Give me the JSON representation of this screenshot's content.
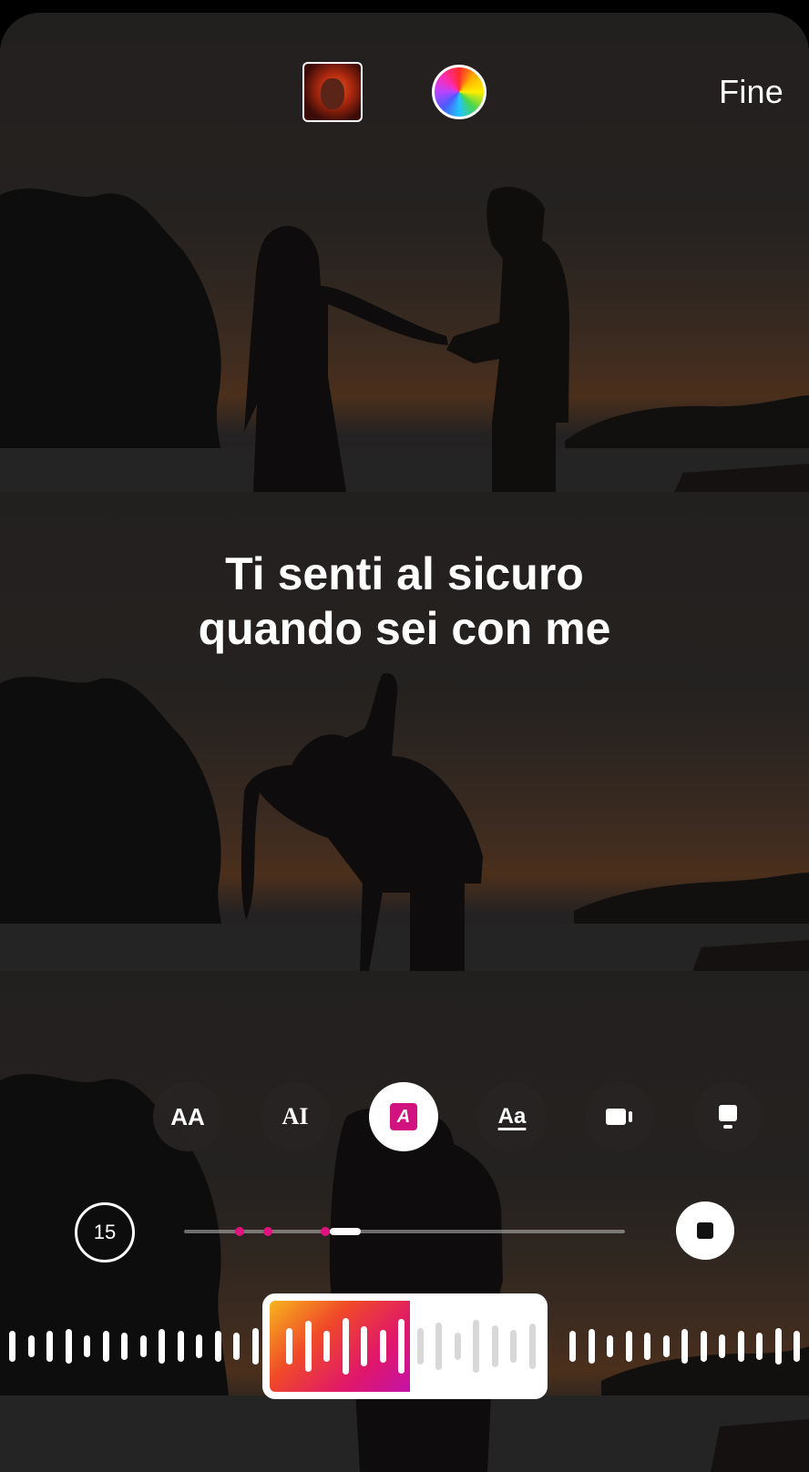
{
  "top_bar": {
    "album_art_icon": "album-cover",
    "color_picker_icon": "color-wheel-icon",
    "done_label": "Fine"
  },
  "lyrics": {
    "line1": "Ti senti al sicuro",
    "line2": "quando sei con me"
  },
  "style_buttons": [
    {
      "icon": "text-style-aa-icon",
      "label": "AA"
    },
    {
      "icon": "text-style-ai-icon",
      "label": "AI"
    },
    {
      "icon": "text-style-highlight-icon",
      "label": "A",
      "active": true
    },
    {
      "icon": "text-style-underline-icon",
      "label": "Aa"
    },
    {
      "icon": "video-clip-icon",
      "label": ""
    },
    {
      "icon": "card-icon",
      "label": ""
    }
  ],
  "playback": {
    "duration_seconds": "15",
    "stop_icon": "stop-icon"
  },
  "colors": {
    "accent": "#d1127f",
    "gradient_start": "#f7b51e",
    "gradient_end": "#c412a8"
  }
}
